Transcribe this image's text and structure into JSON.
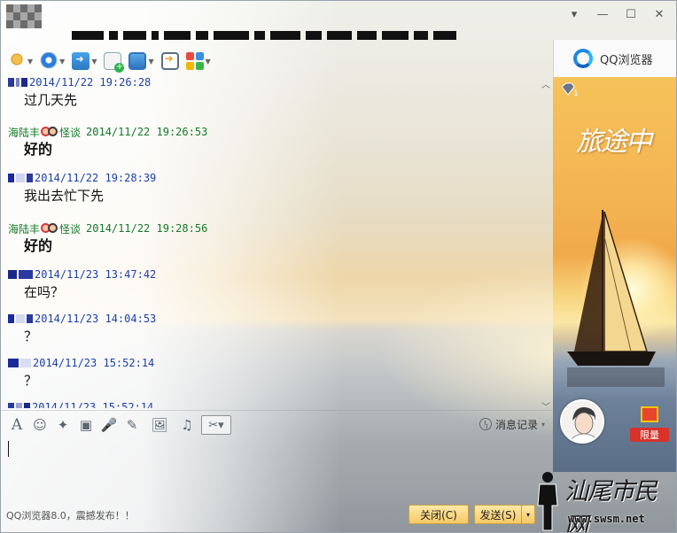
{
  "window": {
    "controls": {
      "menu": "▾",
      "minimize": "—",
      "maximize": "☐",
      "close": "✕"
    }
  },
  "toolbar": {
    "items": [
      {
        "icon": "microphone-icon",
        "has_dropdown": true
      },
      {
        "icon": "webcam-icon",
        "has_dropdown": true
      },
      {
        "icon": "send-file-icon",
        "has_dropdown": true
      },
      {
        "icon": "new-discussion-icon",
        "has_dropdown": false
      },
      {
        "icon": "remote-desktop-icon",
        "has_dropdown": true
      },
      {
        "icon": "share-screen-icon",
        "has_dropdown": false
      },
      {
        "icon": "apps-icon",
        "has_dropdown": true
      }
    ]
  },
  "chat": {
    "messages": [
      {
        "sender": "self",
        "time": "2014/11/22 19:26:28",
        "text": "过几天先",
        "bold": false
      },
      {
        "sender": "peer",
        "name": "海陆丰",
        "nick_suffix": "怪谈",
        "time": "2014/11/22 19:26:53",
        "text": "好的",
        "bold": true
      },
      {
        "sender": "self",
        "time": "2014/11/22 19:28:39",
        "text": "我出去忙下先",
        "bold": false
      },
      {
        "sender": "peer",
        "name": "海陆丰",
        "nick_suffix": "怪谈",
        "time": "2014/11/22 19:28:56",
        "text": "好的",
        "bold": true
      },
      {
        "sender": "self",
        "time": "2014/11/23 13:47:42",
        "text": "在吗？",
        "bold": false
      },
      {
        "sender": "self",
        "time": "2014/11/23 14:04:53",
        "text": "？",
        "bold": false
      },
      {
        "sender": "self",
        "time": "2014/11/23 15:52:14",
        "text": "？",
        "bold": false
      },
      {
        "sender": "self",
        "time": "2014/11/23 15:52:14",
        "text": "",
        "bold": false
      }
    ]
  },
  "input_toolbar": {
    "font": "A",
    "emoji": "☺",
    "shake": "✦",
    "screenshot": "▣",
    "voice": "🎤",
    "handwrite": "✎",
    "image": "🖼",
    "music": "♫",
    "scissor": "✂▾",
    "history_label": "消息记录",
    "history_caret": "▾"
  },
  "footer": {
    "ad_text": "QQ浏览器8.0，震撼发布！！",
    "close_label": "关闭(C)",
    "send_label": "发送(S)",
    "send_caret": "▾"
  },
  "side": {
    "brand_label": "QQ浏览器",
    "banner_text": "旅途中",
    "diamond_level": "1",
    "gift_label": "限量"
  },
  "watermark": {
    "text": "汕尾市民网",
    "url": "www.swsm.net"
  },
  "colors": {
    "self_time": "#1b3fa8",
    "peer_time": "#147a2a",
    "button_bg": "#f5c864",
    "brand_blue": "#1e88e5"
  }
}
